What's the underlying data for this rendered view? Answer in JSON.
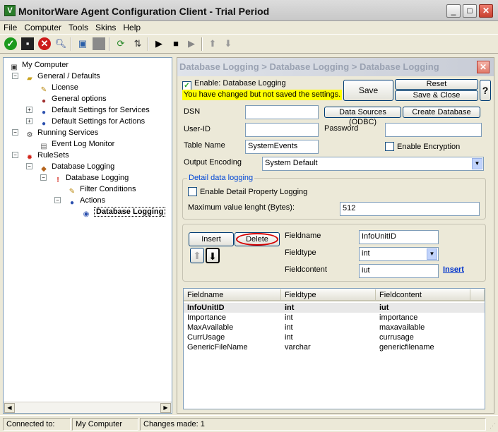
{
  "window": {
    "title": "MonitorWare Agent Configuration Client - Trial Period",
    "app_icon_letter": "V"
  },
  "menu": [
    "File",
    "Computer",
    "Tools",
    "Skins",
    "Help"
  ],
  "tree": {
    "root": "My Computer",
    "general": "General / Defaults",
    "license": "License",
    "general_options": "General options",
    "default_services": "Default Settings for Services",
    "default_actions": "Default Settings for Actions",
    "running_services": "Running Services",
    "event_log_monitor": "Event Log Monitor",
    "rulesets": "RuleSets",
    "db_logging_ruleset": "Database Logging",
    "db_logging_rule": "Database Logging",
    "filter_conditions": "Filter Conditions",
    "actions": "Actions",
    "db_logging_action": "Database Logging"
  },
  "panel": {
    "breadcrumb": "Database Logging > Database Logging > Database Logging",
    "enable_label": "Enable: Database Logging",
    "enable_checked": true,
    "unsaved_warning": "You have changed but not saved the settings.",
    "save": "Save",
    "reset": "Reset",
    "save_close": "Save & Close",
    "help": "?",
    "dsn_label": "DSN",
    "dsn_value": "",
    "data_sources_btn": "Data Sources (ODBC)",
    "create_db_btn": "Create Database",
    "userid_label": "User-ID",
    "userid_value": "",
    "password_label": "Password",
    "password_value": "",
    "table_name_label": "Table Name",
    "table_name_value": "SystemEvents",
    "enable_encryption_label": "Enable Encryption",
    "output_encoding_label": "Output Encoding",
    "output_encoding_value": "System Default",
    "detail_group_title": "Detail data logging",
    "detail_property_label": "Enable Detail Property Logging",
    "max_value_label": "Maximum value lenght (Bytes):",
    "max_value": "512",
    "insert_btn": "Insert",
    "delete_btn": "Delete",
    "fieldname_label": "Fieldname",
    "fieldname_value": "InfoUnitID",
    "fieldtype_label": "Fieldtype",
    "fieldtype_value": "int",
    "fieldcontent_label": "Fieldcontent",
    "fieldcontent_value": "iut",
    "insert_link": "Insert"
  },
  "grid": {
    "columns": [
      "Fieldname",
      "Fieldtype",
      "Fieldcontent"
    ],
    "rows": [
      [
        "InfoUnitID",
        "int",
        "iut"
      ],
      [
        "Importance",
        "int",
        "importance"
      ],
      [
        "MaxAvailable",
        "int",
        "maxavailable"
      ],
      [
        "CurrUsage",
        "int",
        "currusage"
      ],
      [
        "GenericFileName",
        "varchar",
        "genericfilename"
      ]
    ]
  },
  "status": {
    "connected_label": "Connected to:",
    "computer": "My Computer",
    "changes": "Changes made: 1"
  },
  "colors": {
    "warning_bg": "#ffff00",
    "link": "#0033cc",
    "delete_circle": "#d40000"
  }
}
